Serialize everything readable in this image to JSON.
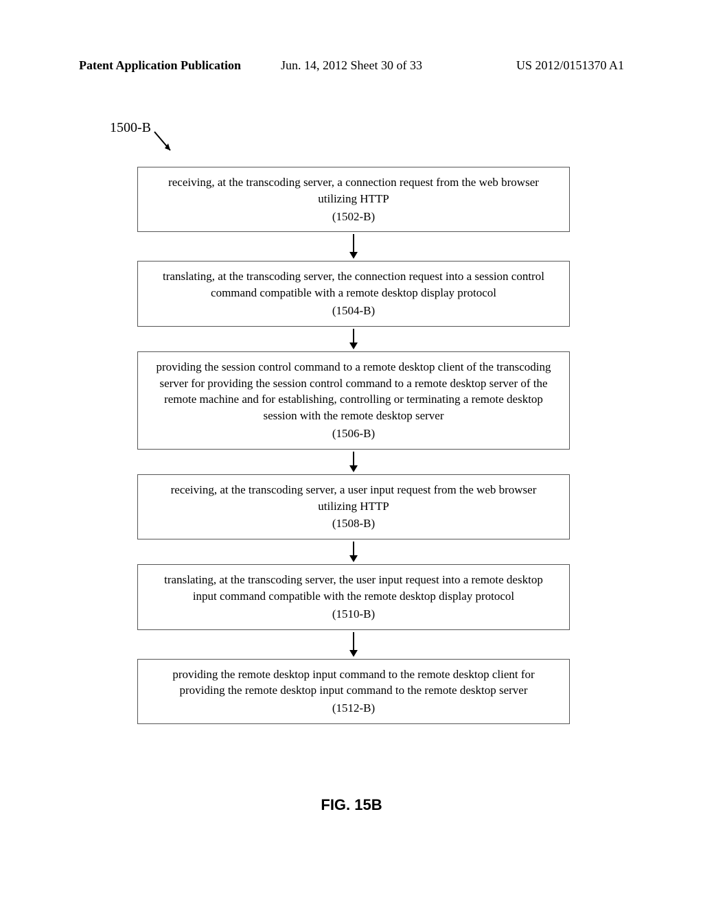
{
  "header": {
    "left": "Patent Application Publication",
    "center": "Jun. 14, 2012  Sheet 30 of 33",
    "right": "US 2012/0151370 A1"
  },
  "figure": {
    "label": "1500-B",
    "caption": "FIG. 15B"
  },
  "steps": [
    {
      "text": "receiving, at the transcoding server, a connection request from the web browser utilizing HTTP",
      "ref": "(1502-B)"
    },
    {
      "text": "translating, at the transcoding server, the connection request into a session control command compatible with a remote desktop display protocol",
      "ref": "(1504-B)"
    },
    {
      "text": "providing the session control command to a remote desktop client of the transcoding server for providing the session control command to a remote desktop server of the remote machine and for establishing, controlling or terminating a remote desktop session with the remote desktop server",
      "ref": "(1506-B)"
    },
    {
      "text": "receiving, at the transcoding server, a user input request from the web browser utilizing HTTP",
      "ref": "(1508-B)"
    },
    {
      "text": "translating, at the transcoding server, the user input request into a remote desktop input command compatible with the remote desktop display protocol",
      "ref": "(1510-B)"
    },
    {
      "text": "providing the remote desktop input command to the remote desktop client for providing the remote desktop input command to the remote desktop server",
      "ref": "(1512-B)"
    }
  ]
}
